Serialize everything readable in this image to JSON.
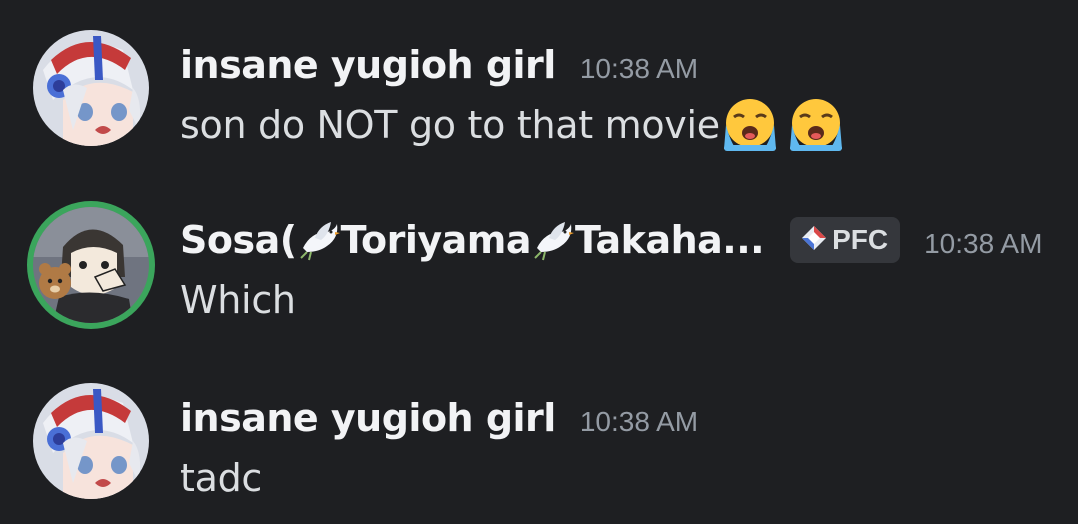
{
  "messages": [
    {
      "username": "insane yugioh girl",
      "timestamp": "10:38 AM",
      "text": "son do NOT go to that movie",
      "emojis": [
        "loudly-crying-face-icon",
        "loudly-crying-face-icon"
      ]
    },
    {
      "username_parts": [
        "Sosa(",
        "Toriyama",
        "Takaha..."
      ],
      "username_emoji": "dove-icon",
      "timestamp": "10:38 AM",
      "tag": {
        "label": "PFC",
        "icon": "diamond-icon"
      },
      "text": "Which",
      "avatar_ring_color": "#3ba55c"
    },
    {
      "username": "insane yugioh girl",
      "timestamp": "10:38 AM",
      "text": "tadc"
    }
  ],
  "colors": {
    "background": "#1e1f22",
    "username": "#f2f3f5",
    "text": "#dbdee1",
    "timestamp": "#949ba4",
    "tag_bg": "#35373c"
  }
}
